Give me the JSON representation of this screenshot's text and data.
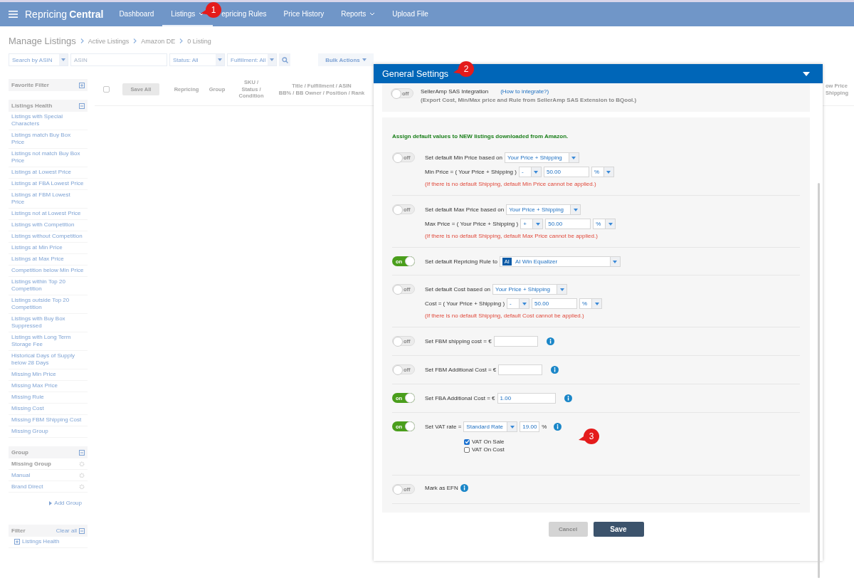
{
  "nav": {
    "brand_light": "Repricing",
    "brand_bold": "Central",
    "items": [
      {
        "label": "Dashboard",
        "selected": false,
        "dropdown": false
      },
      {
        "label": "Listings",
        "selected": true,
        "dropdown": true
      },
      {
        "label": "epricing Rules",
        "selected": false,
        "dropdown": false
      },
      {
        "label": "Price History",
        "selected": false,
        "dropdown": false
      },
      {
        "label": "Reports",
        "selected": false,
        "dropdown": true
      },
      {
        "label": "Upload File",
        "selected": false,
        "dropdown": false
      }
    ]
  },
  "breadcrumb": {
    "title": "Manage Listings",
    "crumbs": [
      "Active Listings",
      "Amazon DE",
      "0 Listing"
    ]
  },
  "toolbar": {
    "search_by": "Search by ASIN",
    "search_placeholder": "ASIN",
    "status": "Status: All",
    "fulfillment": "Fulfillment: All",
    "bulk_actions": "Bulk Actions"
  },
  "sidebar": {
    "favorite_title": "Favorite Filter",
    "health_title": "Listings Health",
    "health_items": [
      "Listings with Special Characters",
      "Listings match Buy Box Price",
      "Listings not match Buy Box Price",
      "Listings at Lowest Price",
      "Listings at FBA Lowest Price",
      "Listings at FBM Lowest Price",
      "Listings not at Lowest Price",
      "Listings with Competition",
      "Listings without Competition",
      "Listings at Min Price",
      "Listings at Max Price",
      "Competition below Min Price",
      "Listings within Top 20 Competition",
      "Listings outside Top 20 Competition",
      "Listings with Buy Box Suppressed",
      "Listings with Long Term Storage Fee",
      "Historical Days of Supply below 28 Days",
      "Missing Min Price",
      "Missing Max Price",
      "Missing Rule",
      "Missing Cost",
      "Missing FBM Shipping Cost",
      "Missing Group"
    ],
    "group_title": "Group",
    "groups": [
      {
        "label": "Missing Group",
        "selected": true
      },
      {
        "label": "Manual",
        "selected": false
      },
      {
        "label": "Brand Direct",
        "selected": false
      }
    ],
    "add_group": "Add Group",
    "filter_title": "Filter",
    "clear_all": "Clear all",
    "filter_items": [
      "Listings Health"
    ]
  },
  "table": {
    "select_all_checked": false,
    "save_all": "Save All",
    "columns": [
      [
        "Repricing"
      ],
      [
        "Group"
      ],
      [
        "SKU /",
        "Status /",
        "Condition"
      ],
      [
        "Title / Fulfillment / ASIN",
        "BB% / BB Owner / Position / Rank"
      ]
    ],
    "column_7": [
      "ow Price",
      "Shipping"
    ]
  },
  "modal": {
    "title": "General Settings",
    "sas": {
      "on": false,
      "toggle_label": "off",
      "label": "SellerAmp SAS Integration",
      "link": "(How to integrate?)",
      "note": "(Export Cost, Min/Max price and Rule from SellerAmp SAS Extension to BQool.)"
    },
    "intro": "Assign default values to **NEW** listings downloaded from Amazon.",
    "settings": [
      {
        "kind": "formula",
        "on": false,
        "toggle_label": "off",
        "label": "Set default Min Price based on",
        "basis": "Your Price + Shipping",
        "formula": "Min Price = ( Your Price + Shipping )",
        "operator": "-",
        "value": "50.00",
        "unit": "%",
        "warning": "(If there is no default Shipping, default Min Price cannot be applied.)"
      },
      {
        "kind": "formula",
        "on": false,
        "toggle_label": "off",
        "label": "Set default Max Price based on",
        "basis": "Your Price + Shipping",
        "formula": "Max Price = ( Your Price + Shipping )",
        "operator": "+",
        "value": "50.00",
        "unit": "%",
        "warning": "(If there is no default Shipping, default Max Price cannot be applied.)"
      },
      {
        "kind": "rule",
        "on": true,
        "toggle_label": "on",
        "label": "Set default Repricing Rule to",
        "tag": "AI",
        "rule": "AI Win Equalizer"
      },
      {
        "kind": "formula",
        "on": false,
        "toggle_label": "off",
        "label": "Set default Cost based on",
        "basis": "Your Price + Shipping",
        "formula": "Cost = ( Your Price + Shipping )",
        "operator": "-",
        "value": "50.00",
        "unit": "%",
        "warning": "(If there is no default Shipping, default Cost cannot be applied.)"
      },
      {
        "kind": "amount",
        "on": false,
        "toggle_label": "off",
        "label": "Set FBM shipping cost = €"
      },
      {
        "kind": "amount",
        "on": false,
        "toggle_label": "off",
        "label": "Set FBM Additional Cost = €"
      },
      {
        "kind": "amount",
        "on": true,
        "toggle_label": "on",
        "label": "Set FBA Additional Cost = €",
        "value": "1.00"
      },
      {
        "kind": "vat",
        "on": true,
        "toggle_label": "on",
        "label": "Set VAT rate =",
        "rate": "Standard Rate",
        "value": "19.00",
        "unit": "%",
        "checks": [
          {
            "label": "VAT On Sale",
            "checked": true
          },
          {
            "label": "VAT On Cost",
            "checked": false
          }
        ]
      },
      {
        "kind": "flag",
        "on": false,
        "toggle_label": "off",
        "label": "Mark as EFN"
      }
    ],
    "buttons": [
      {
        "label": "Cancel",
        "disabled": true
      },
      {
        "label": "Save",
        "disabled": false
      }
    ]
  },
  "annotations": [
    "1",
    "2",
    "3"
  ]
}
